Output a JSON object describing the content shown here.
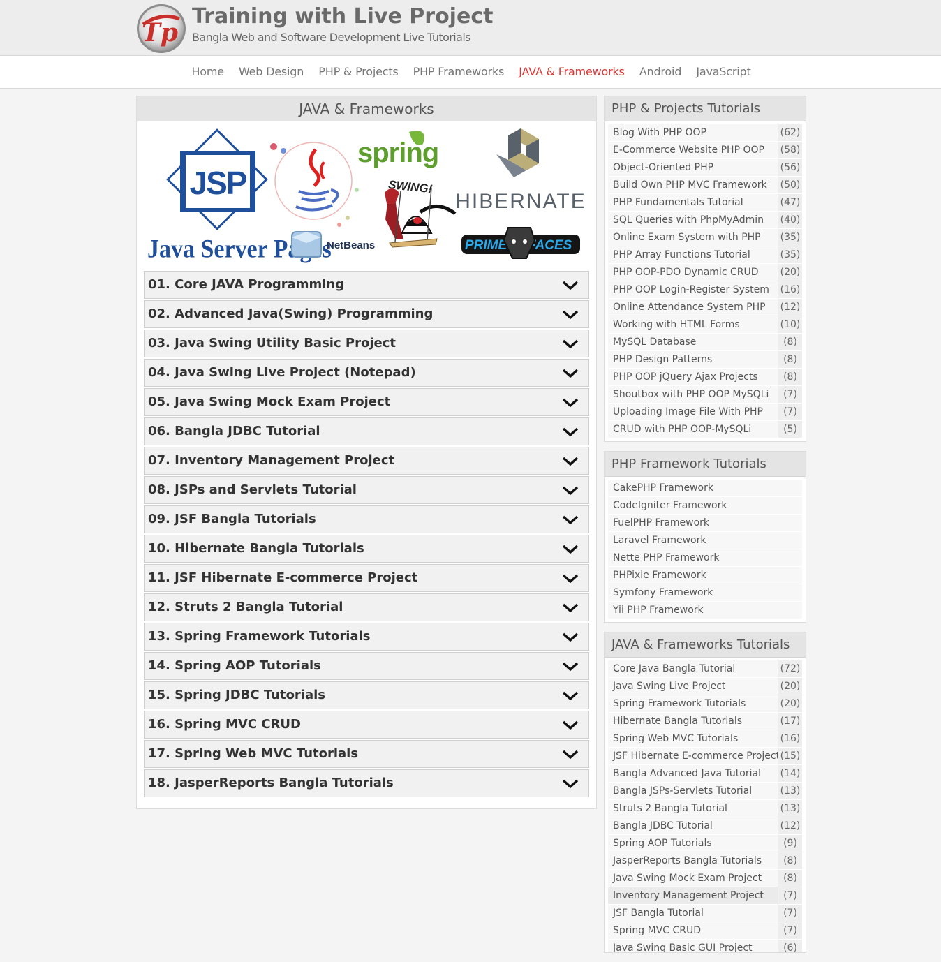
{
  "header": {
    "title": "Training with Live Project",
    "tagline": "Bangla Web and Software Development Live Tutorials",
    "logo_text": "Tp"
  },
  "nav": [
    {
      "label": "Home",
      "active": false
    },
    {
      "label": "Web Design",
      "active": false
    },
    {
      "label": "PHP & Projects",
      "active": false
    },
    {
      "label": "PHP Frameworks",
      "active": false
    },
    {
      "label": "JAVA & Frameworks",
      "active": true
    },
    {
      "label": "Android",
      "active": false
    },
    {
      "label": "JavaScript",
      "active": false
    }
  ],
  "main": {
    "heading": "JAVA & Frameworks",
    "banner": {
      "jsp": "JSP",
      "jsp_caption": "Java Server Pages",
      "spring": "spring",
      "swing": "SWING!",
      "hibernate": "HIBERNATE",
      "netbeans": "NetBeans",
      "prime": "PRIME",
      "faces": "FACES"
    },
    "accordion": [
      "01. Core JAVA Programming",
      "02. Advanced Java(Swing) Programming",
      "03. Java Swing Utility Basic Project",
      "04. Java Swing Live Project (Notepad)",
      "05. Java Swing Mock Exam Project",
      "06. Bangla JDBC Tutorial",
      "07. Inventory Management Project",
      "08. JSPs and Servlets Tutorial",
      "09. JSF Bangla Tutorials",
      "10. Hibernate Bangla Tutorials",
      "11. JSF Hibernate E-commerce Project",
      "12. Struts 2 Bangla Tutorial",
      "13. Spring Framework Tutorials",
      "14. Spring AOP Tutorials",
      "15. Spring JDBC Tutorials",
      "16. Spring MVC CRUD",
      "17. Spring Web MVC Tutorials",
      "18. JasperReports Bangla Tutorials"
    ]
  },
  "sidebar": {
    "php_projects": {
      "title": "PHP & Projects Tutorials",
      "items": [
        {
          "name": "Blog With PHP OOP",
          "count": "(62)"
        },
        {
          "name": "E-Commerce Website PHP OOP",
          "count": "(58)"
        },
        {
          "name": "Object-Oriented PHP",
          "count": "(56)"
        },
        {
          "name": "Build Own PHP MVC Framework",
          "count": "(50)"
        },
        {
          "name": "PHP Fundamentals Tutorial",
          "count": "(47)"
        },
        {
          "name": "SQL Queries with PhpMyAdmin",
          "count": "(40)"
        },
        {
          "name": "Online Exam System with PHP",
          "count": "(35)"
        },
        {
          "name": "PHP Array Functions Tutorial",
          "count": "(35)"
        },
        {
          "name": "PHP OOP-PDO Dynamic CRUD",
          "count": "(20)"
        },
        {
          "name": "PHP OOP Login-Register System",
          "count": "(16)"
        },
        {
          "name": "Online Attendance System PHP",
          "count": "(12)"
        },
        {
          "name": "Working with HTML Forms",
          "count": "(10)"
        },
        {
          "name": "MySQL Database",
          "count": "(8)"
        },
        {
          "name": "PHP Design Patterns",
          "count": "(8)"
        },
        {
          "name": "PHP OOP jQuery Ajax Projects",
          "count": "(8)"
        },
        {
          "name": "Shoutbox with PHP OOP MySQLi",
          "count": "(7)"
        },
        {
          "name": "Uploading Image File With PHP",
          "count": "(7)"
        },
        {
          "name": "CRUD with PHP OOP-MySQLi",
          "count": "(5)"
        }
      ]
    },
    "php_frameworks": {
      "title": "PHP Framework Tutorials",
      "items": [
        "CakePHP Framework",
        "CodeIgniter Framework",
        "FuelPHP Framework",
        "Laravel Framework",
        "Nette PHP Framework",
        "PHPixie Framework",
        "Symfony Framework",
        "Yii PHP Framework"
      ]
    },
    "java_frameworks": {
      "title": "JAVA & Frameworks Tutorials",
      "items": [
        {
          "name": "Core Java Bangla Tutorial",
          "count": "(72)"
        },
        {
          "name": "Java Swing Live Project",
          "count": "(20)"
        },
        {
          "name": "Spring Framework Tutorials",
          "count": "(20)"
        },
        {
          "name": "Hibernate Bangla Tutorials",
          "count": "(17)"
        },
        {
          "name": "Spring Web MVC Tutorials",
          "count": "(16)"
        },
        {
          "name": "JSF Hibernate E-commerce Project",
          "count": "(15)"
        },
        {
          "name": "Bangla Advanced Java Tutorial",
          "count": "(14)"
        },
        {
          "name": "Bangla JSPs-Servlets Tutorial",
          "count": "(13)"
        },
        {
          "name": "Struts 2 Bangla Tutorial",
          "count": "(13)"
        },
        {
          "name": "Bangla JDBC Tutorial",
          "count": "(12)"
        },
        {
          "name": "Spring AOP Tutorials",
          "count": "(9)"
        },
        {
          "name": "JasperReports Bangla Tutorials",
          "count": "(8)"
        },
        {
          "name": "Java Swing Mock Exam Project",
          "count": "(8)"
        },
        {
          "name": "Inventory Management Project",
          "count": "(7)"
        },
        {
          "name": "JSF Bangla Tutorial",
          "count": "(7)"
        },
        {
          "name": "Spring MVC CRUD",
          "count": "(7)"
        },
        {
          "name": "Java Swing Basic GUI Project",
          "count": "(6)"
        }
      ]
    }
  }
}
